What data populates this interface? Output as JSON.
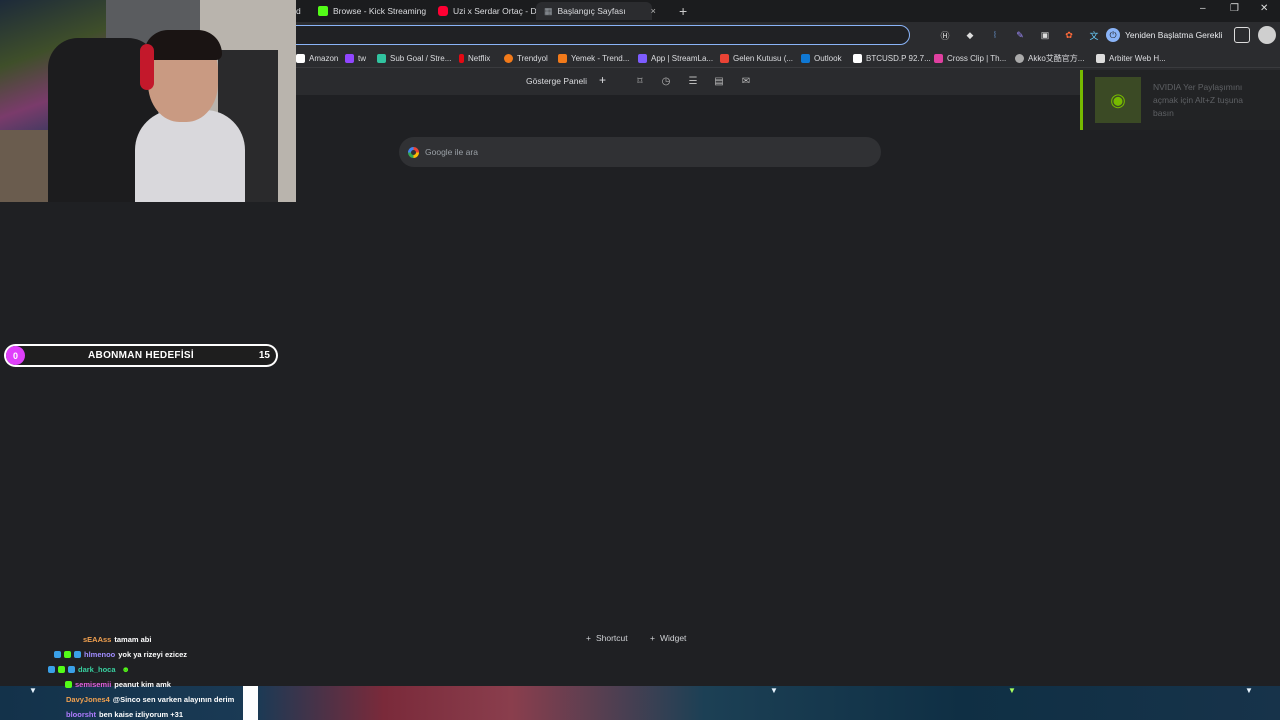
{
  "browser": {
    "tabs": [
      {
        "label": "d",
        "icon": "tab-fragment-icon",
        "color": "#888888"
      },
      {
        "label": "Browse - Kick Streaming",
        "icon": "kick-icon",
        "color": "#53fc18"
      },
      {
        "label": "Uzi x Serdar Ortaç - DAN",
        "icon": "youtube-icon",
        "color": "#ff0033"
      },
      {
        "label": "Başlangıç Sayfası",
        "icon": "grid-icon",
        "color": "#9aa0a6",
        "close": "×"
      }
    ],
    "new_tab": "+",
    "window_controls": {
      "minimize": "–",
      "maximize": "❐",
      "close": "✕"
    },
    "restart_label": "Yeniden Başlatma Gerekli",
    "bookmarks": [
      {
        "label": "Amazon",
        "color": "#ffffff"
      },
      {
        "label": "tw",
        "color": "#9146ff"
      },
      {
        "label": "Sub Goal / Stre...",
        "color": "#31c4a0"
      },
      {
        "label": "Netflix",
        "color": "#e50914"
      },
      {
        "label": "Trendyol",
        "color": "#f27a1a"
      },
      {
        "label": "Yemek - Trend...",
        "color": "#f27a1a"
      },
      {
        "label": "App | StreamLa...",
        "color": "#7d5cff"
      },
      {
        "label": "Gelen Kutusu (...",
        "color": "#ea4335"
      },
      {
        "label": "Outlook",
        "color": "#0f78d4"
      },
      {
        "label": "BTCUSD.P 92.7...",
        "color": "#ffffff"
      },
      {
        "label": "Cross Clip | Th...",
        "color": "#e040a0"
      },
      {
        "label": "Akko艾酷官方...",
        "color": "#aaaaaa"
      },
      {
        "label": "Arbiter Web H...",
        "color": "#dddddd"
      }
    ]
  },
  "page": {
    "dashboard_label": "Gösterge Paneli",
    "dashboard_plus": "+",
    "search_placeholder": "Google ile ara",
    "shortcut_label": "Shortcut",
    "widget_label": "Widget",
    "plus": "+"
  },
  "nvidia_toast": {
    "text": "NVIDIA Yer Paylaşımını açmak için Alt+Z tuşuna basın"
  },
  "sub_goal": {
    "start": "0",
    "title": "ABONMAN HEDEFİSİ",
    "end": "15"
  },
  "chat": [
    {
      "user": "sEAAss",
      "text": "tamam abi",
      "user_color": "#f0a050",
      "badges": []
    },
    {
      "user": "hlmenoo",
      "text": "yok ya rizeyi ezicez",
      "user_color": "#a08cff",
      "badges": [
        "#3aa0e8",
        "#53fc18",
        "#3aa0e8"
      ]
    },
    {
      "user": "dark_hoca",
      "text": "",
      "user_color": "#38d0a0",
      "badges": [
        "#3aa0e8",
        "#53fc18",
        "#3aa0e8"
      ]
    },
    {
      "user": "semisemii",
      "text": "peanut kim amk",
      "user_color": "#e060e0",
      "badges": [
        "#53fc18"
      ]
    },
    {
      "user": "DavyJones4",
      "text": "@Sinco sen varken alayının derim",
      "user_color": "#f0a050",
      "badges": []
    },
    {
      "user": "bloorsht",
      "text": "ben kaise izliyorum +31",
      "user_color": "#b07cff",
      "badges": []
    }
  ]
}
